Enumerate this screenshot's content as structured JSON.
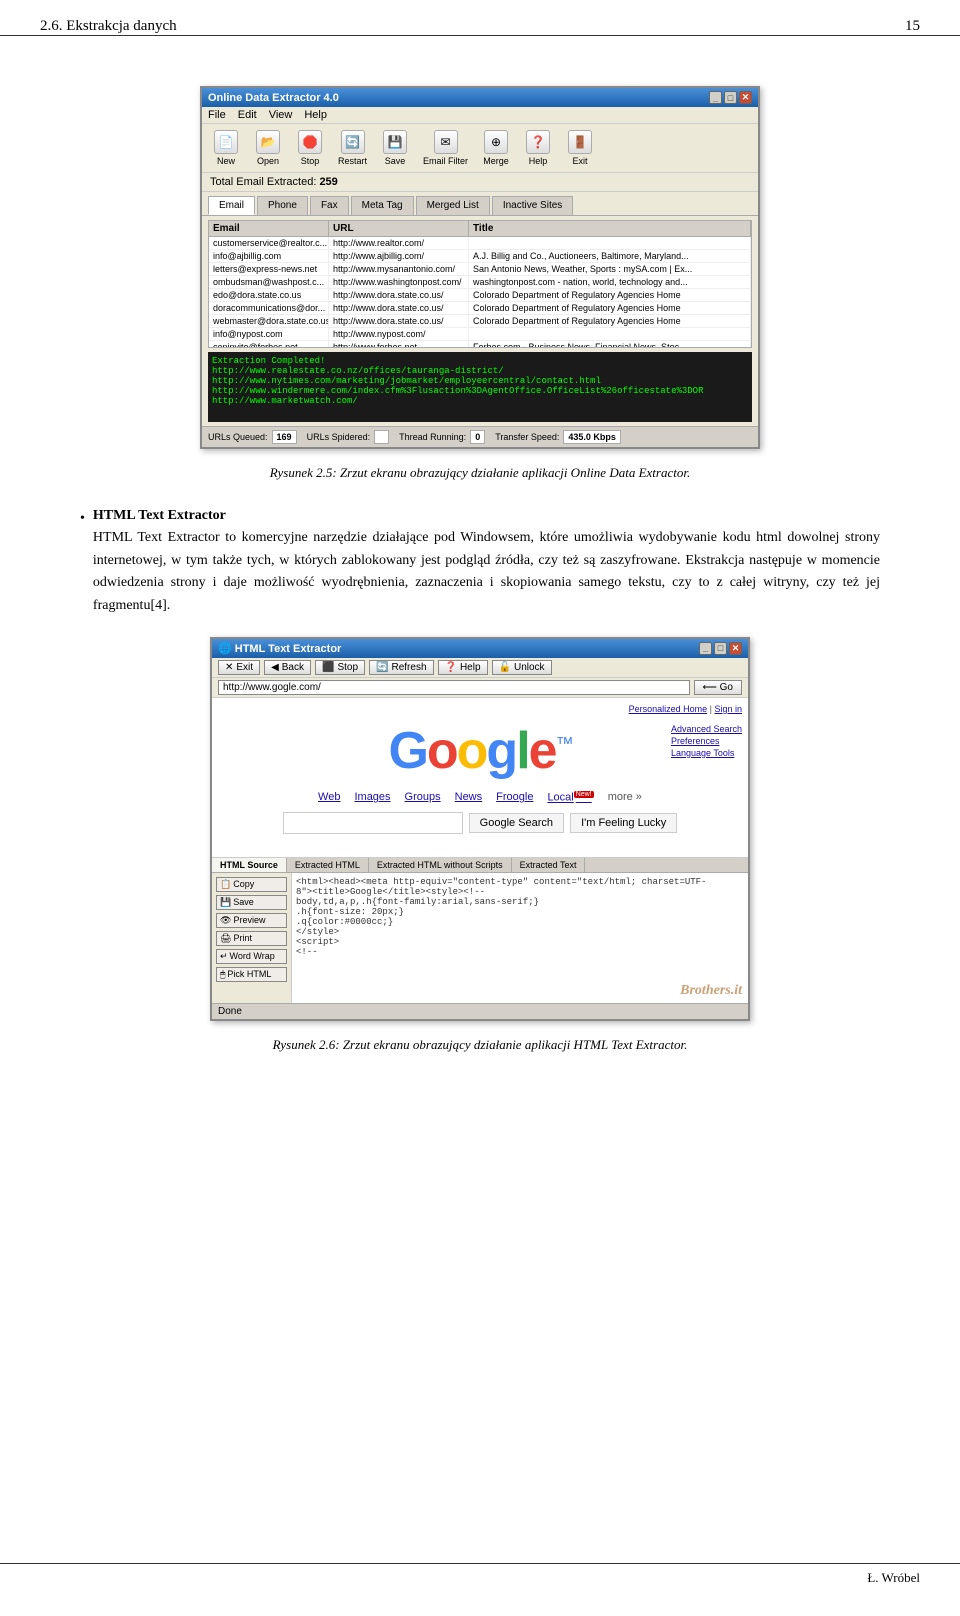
{
  "header": {
    "chapter": "2.6. Ekstrakcja danych",
    "page_number": "15"
  },
  "figure1": {
    "app_title": "Online Data Extractor 4.0",
    "menu": [
      "File",
      "Edit",
      "View",
      "Help"
    ],
    "toolbar_buttons": [
      "New",
      "Open",
      "Stop",
      "Restart",
      "Save",
      "Email Filter",
      "Merge",
      "Help",
      "Exit"
    ],
    "status_line": "Total Email Extracted: 259",
    "tabs": [
      "Email",
      "Phone",
      "Fax",
      "Meta Tag",
      "Merged List",
      "Inactive Sites"
    ],
    "table_headers": [
      "Email",
      "URL",
      "Title"
    ],
    "table_rows": [
      [
        "customerservice@realtor.c...",
        "http://www.realtor.com/",
        ""
      ],
      [
        "info@ajbillig.com",
        "http://www.ajbillig.com/",
        "A.J. Billig and Co., Auctioneers, Baltimore, Maryland..."
      ],
      [
        "letters@express-news.net",
        "http://www.mysanantonio.com/",
        "San Antonio News, Weather, Sports : mySA.com | Ex..."
      ],
      [
        "ombudsman@washpost.c...",
        "http://www.washingtonpost.com/",
        "washingtonpost.com - nation, world, technology and..."
      ],
      [
        "edo@dora.state.co.us",
        "http://www.dora.state.co.us/",
        "Colorado Department of Regulatory Agencies Home"
      ],
      [
        "doracommunications@dor...",
        "http://www.dora.state.co.us/",
        "Colorado Department of Regulatory Agencies Home"
      ],
      [
        "webmaster@dora.state.co.us",
        "http://www.dora.state.co.us/",
        "Colorado Department of Regulatory Agencies Home"
      ],
      [
        "info@nypost.com",
        "http://www.nypost.com/",
        ""
      ],
      [
        "cepinvite@forbes.net",
        "http://www.forbes.net",
        "Forbes.com - Business News, Financial News, Stoc..."
      ]
    ],
    "log_lines": [
      "Extraction Completed!",
      "http://www.realestate.co.nz/offices/tauranga-district/",
      "http://www.nytimes.com/marketing/jobmarket/employeercentral/contact.html",
      "http://www.windermere.com/index.cfm%3Flusaction%3DAgentOffice.OfficeList%26officestate%3DOR",
      "http://www.marketwatch.com/"
    ],
    "bottom_stats": [
      {
        "label": "URLs Queued:",
        "value": "169"
      },
      {
        "label": "URLs Spidered:",
        "value": ""
      },
      {
        "label": "Thread Running:",
        "value": "0"
      },
      {
        "label": "Transfer Speed:",
        "value": "435.0 Kbps"
      }
    ],
    "caption": "Rysunek 2.5: Zrzut ekranu obrazujący działanie aplikacji Online Data Extractor."
  },
  "body_text": {
    "bullet_marker": "•",
    "section_title": "HTML Text Extractor",
    "paragraph": "HTML Text Extractor to komercyjne narzędzie działające pod Windowsem, które umożliwia wydobywanie kodu html dowolnej strony internetowej, w tym także tych, w których zablokowany jest podgląd źródła, czy też są zaszyfrowane. Ekstrakcja następuje w momencie odwiedzenia strony i daje możliwość wyodrębnienia, zaznaczenia i skopiowania samego tekstu, czy to z całej witryny, czy też jej fragmentu[4]."
  },
  "figure2": {
    "app_title": "HTML Text Extractor",
    "toolbar_buttons": [
      "Exit",
      "Back",
      "Stop",
      "Refresh",
      "Help",
      "Unlock"
    ],
    "url_value": "http://www.gogle.com/",
    "go_label": "Go",
    "personalized_text": "Personalized Home | Sign in",
    "nav_links": [
      "Web",
      "Images",
      "Groups",
      "News",
      "Froogle",
      "Local"
    ],
    "new_badge": "New!",
    "more_label": "more »",
    "search_placeholder": "",
    "search_btn1": "Google Search",
    "search_btn2": "I'm Feeling Lucky",
    "right_links": [
      "Advanced Search",
      "Preferences",
      "Language Tools"
    ],
    "extract_tabs": [
      "HTML Source",
      "Extracted HTML",
      "Extracted HTML without Scripts",
      "Extracted Text"
    ],
    "left_panel_buttons": [
      "Copy",
      "Save",
      "Preview",
      "Print",
      "Word Wrap",
      "Pick HTML"
    ],
    "code_content": "<html><head><meta http-equiv=\"content-type\" content=\"text/html; charset=UTF-8\"><title>Google</title><style>*{-<br>body,td,a,p,.h{font-family:arial,sans-serif;}<br>.h{font-size: 20px;}<br>.q{color:#0000cc;}<br></style><br><script>",
    "status_text": "Done",
    "watermark": "Brothers.it",
    "caption": "Rysunek 2.6: Zrzut ekranu obrazujący działanie aplikacji HTML Text Extractor."
  },
  "footer": {
    "author": "Ł. Wróbel"
  }
}
